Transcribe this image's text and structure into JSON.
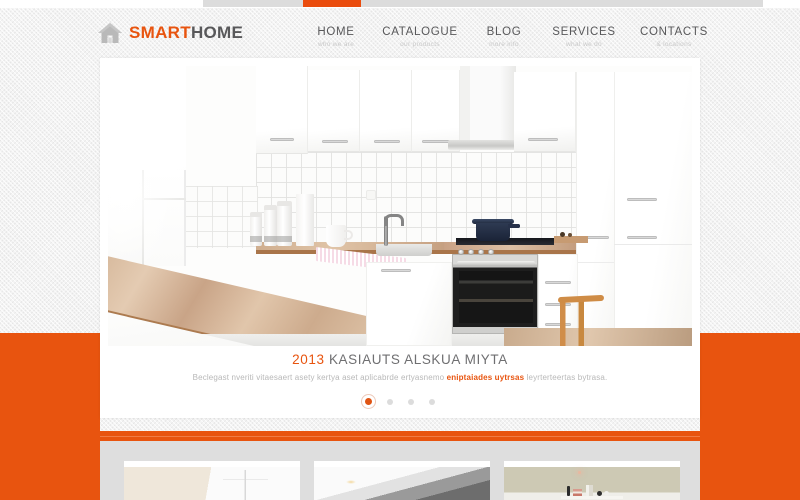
{
  "browser": {
    "active_tab_color": "#ea4c0d"
  },
  "brand": {
    "icon": "house-icon",
    "name_first": "SMART",
    "name_second": "HOME",
    "color_primary": "#e8540f",
    "color_secondary": "#58585a"
  },
  "nav": {
    "items": [
      {
        "label": "HOME",
        "sub": "who we are"
      },
      {
        "label": "CATALOGUE",
        "sub": "our products"
      },
      {
        "label": "BLOG",
        "sub": "more info"
      },
      {
        "label": "SERVICES",
        "sub": "what we do"
      },
      {
        "label": "CONTACTS",
        "sub": "& locations"
      }
    ]
  },
  "slider": {
    "image_alt": "white-modern-kitchen-with-wooden-countertop",
    "caption": {
      "year": "2013",
      "title": "KASIAUTS ALSKUA MIYTA",
      "sub_before": "Beclegast nveriti vitaesaert  asety kertya aset aplicabrde ertyasnemo ",
      "sub_highlight": "eniptaiades uytrsas",
      "sub_after": " leyrterteertas bytrasa."
    },
    "dots": [
      {
        "active": true
      },
      {
        "active": false
      },
      {
        "active": false
      },
      {
        "active": false
      }
    ]
  },
  "gallery": {
    "thumbs": [
      {
        "alt": "beige-room-with-window"
      },
      {
        "alt": "dark-modern-interior-with-spotlight"
      },
      {
        "alt": "olive-wall-with-shelf-and-books"
      }
    ]
  },
  "theme": {
    "accent": "#e8540f",
    "panel_bg": "#ffffff",
    "page_bg": "#f3f3f3",
    "footer_bg": "#dedede",
    "muted_text": "#b8b8b8",
    "heading_text": "#6f6f71"
  }
}
